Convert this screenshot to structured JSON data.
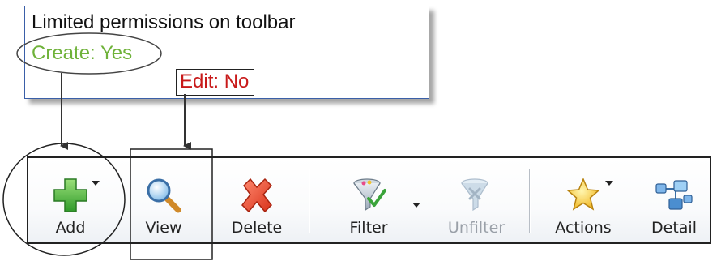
{
  "callout": {
    "title": "Limited permissions on toolbar",
    "create_text": "Create: Yes",
    "edit_text": "Edit: No",
    "colors": {
      "create": "#6fb23a",
      "edit": "#c81a1a",
      "border": "#3a5fa8"
    }
  },
  "toolbar": {
    "buttons": [
      {
        "label": "Add",
        "icon": "plus-icon",
        "has_dropdown": true
      },
      {
        "label": "View",
        "icon": "magnifier-icon",
        "has_dropdown": false
      },
      {
        "label": "Delete",
        "icon": "delete-x-icon",
        "has_dropdown": false
      },
      {
        "label": "Filter",
        "icon": "funnel-check-icon",
        "has_dropdown": true
      },
      {
        "label": "Unfilter",
        "icon": "funnel-clear-icon",
        "has_dropdown": false,
        "disabled": true
      },
      {
        "label": "Actions",
        "icon": "star-icon",
        "has_dropdown": true
      },
      {
        "label": "Detail",
        "icon": "detail-network-icon",
        "has_dropdown": false
      }
    ]
  }
}
